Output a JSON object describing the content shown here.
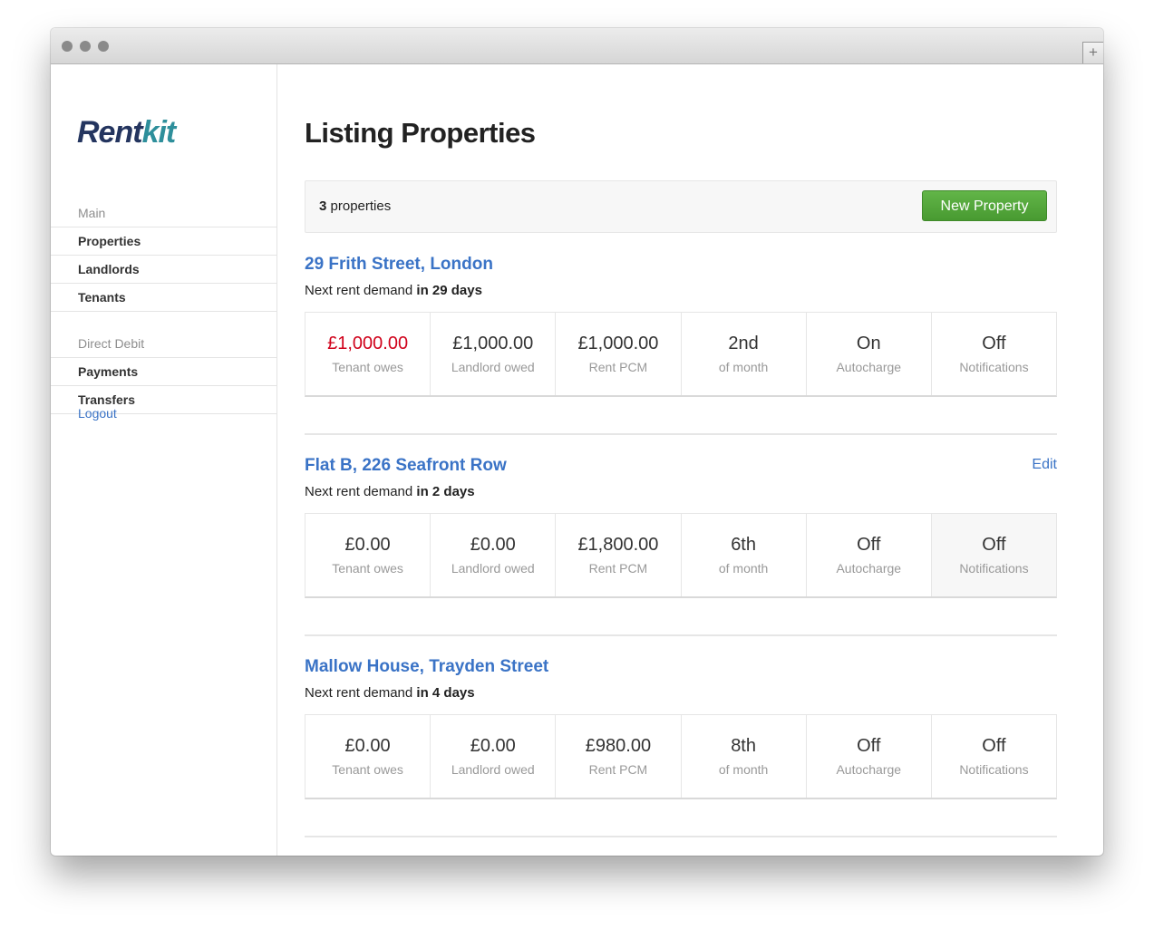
{
  "colors": {
    "accent_link": "#3a73c6",
    "primary_button": "#53a83b",
    "owed_red": "#d0021b",
    "logo_dark": "#24355f",
    "logo_teal": "#2e8f9b"
  },
  "window": {
    "plus_label": "+"
  },
  "sidebar": {
    "logo_part1": "Rent",
    "logo_part2": "kit",
    "sections": [
      {
        "heading": "Main",
        "items": [
          "Properties",
          "Landlords",
          "Tenants"
        ]
      },
      {
        "heading": "Direct Debit",
        "items": [
          "Payments",
          "Transfers"
        ]
      }
    ],
    "logout": "Logout"
  },
  "main": {
    "title": "Listing Properties",
    "toolbar": {
      "count_number": "3",
      "count_label": " properties",
      "new_button": "New Property"
    },
    "properties": [
      {
        "title": "29 Frith Street, London",
        "edit": "",
        "demand_prefix": "Next rent demand ",
        "demand_bold": "in 29 days",
        "stats": [
          {
            "value": "£1,000.00",
            "label": "Tenant owes"
          },
          {
            "value": "£1,000.00",
            "label": "Landlord owed"
          },
          {
            "value": "£1,000.00",
            "label": "Rent PCM"
          },
          {
            "value": "2nd",
            "label": "of month"
          },
          {
            "value": "On",
            "label": "Autocharge"
          },
          {
            "value": "Off",
            "label": "Notifications"
          }
        ]
      },
      {
        "title": "Flat B, 226 Seafront Row",
        "edit": "Edit",
        "demand_prefix": "Next rent demand ",
        "demand_bold": "in 2 days",
        "stats": [
          {
            "value": "£0.00",
            "label": "Tenant owes"
          },
          {
            "value": "£0.00",
            "label": "Landlord owed"
          },
          {
            "value": "£1,800.00",
            "label": "Rent PCM"
          },
          {
            "value": "6th",
            "label": "of month"
          },
          {
            "value": "Off",
            "label": "Autocharge"
          },
          {
            "value": "Off",
            "label": "Notifications"
          }
        ]
      },
      {
        "title": "Mallow House, Trayden Street",
        "edit": "",
        "demand_prefix": "Next rent demand ",
        "demand_bold": "in 4 days",
        "stats": [
          {
            "value": "£0.00",
            "label": "Tenant owes"
          },
          {
            "value": "£0.00",
            "label": "Landlord owed"
          },
          {
            "value": "£980.00",
            "label": "Rent PCM"
          },
          {
            "value": "8th",
            "label": "of month"
          },
          {
            "value": "Off",
            "label": "Autocharge"
          },
          {
            "value": "Off",
            "label": "Notifications"
          }
        ]
      }
    ]
  }
}
